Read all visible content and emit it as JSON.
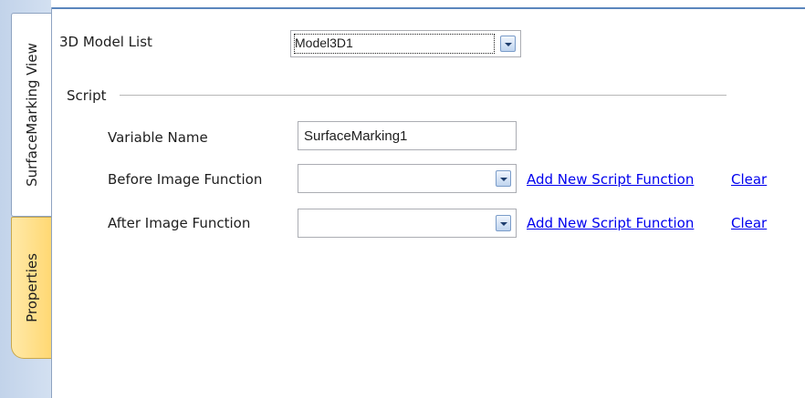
{
  "tabs": [
    {
      "label": "SurfaceMarking View",
      "active": true
    },
    {
      "label": "Properties",
      "active": false
    }
  ],
  "model_list": {
    "label": "3D Model List",
    "selected": "Model3D1"
  },
  "script": {
    "group_label": "Script",
    "variable_name": {
      "label": "Variable Name",
      "value": "SurfaceMarking1"
    },
    "before_image": {
      "label": "Before Image Function",
      "value": "",
      "add_link": "Add New Script Function",
      "clear_link": "Clear"
    },
    "after_image": {
      "label": "After Image Function",
      "value": "",
      "add_link": "Add New Script Function",
      "clear_link": "Clear"
    }
  },
  "colors": {
    "accent_line": "#5b86bd",
    "link": "#0000ee",
    "properties_tab": "#ffd873",
    "sidebar": "#c2d3ea"
  }
}
